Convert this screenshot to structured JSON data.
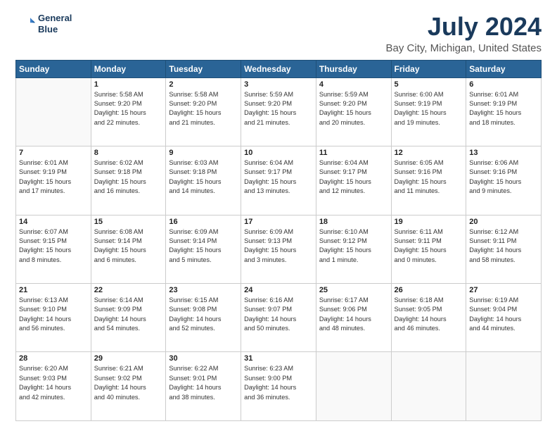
{
  "logo": {
    "line1": "General",
    "line2": "Blue"
  },
  "title": "July 2024",
  "subtitle": "Bay City, Michigan, United States",
  "headers": [
    "Sunday",
    "Monday",
    "Tuesday",
    "Wednesday",
    "Thursday",
    "Friday",
    "Saturday"
  ],
  "weeks": [
    [
      {
        "day": "",
        "info": ""
      },
      {
        "day": "1",
        "info": "Sunrise: 5:58 AM\nSunset: 9:20 PM\nDaylight: 15 hours\nand 22 minutes."
      },
      {
        "day": "2",
        "info": "Sunrise: 5:58 AM\nSunset: 9:20 PM\nDaylight: 15 hours\nand 21 minutes."
      },
      {
        "day": "3",
        "info": "Sunrise: 5:59 AM\nSunset: 9:20 PM\nDaylight: 15 hours\nand 21 minutes."
      },
      {
        "day": "4",
        "info": "Sunrise: 5:59 AM\nSunset: 9:20 PM\nDaylight: 15 hours\nand 20 minutes."
      },
      {
        "day": "5",
        "info": "Sunrise: 6:00 AM\nSunset: 9:19 PM\nDaylight: 15 hours\nand 19 minutes."
      },
      {
        "day": "6",
        "info": "Sunrise: 6:01 AM\nSunset: 9:19 PM\nDaylight: 15 hours\nand 18 minutes."
      }
    ],
    [
      {
        "day": "7",
        "info": "Sunrise: 6:01 AM\nSunset: 9:19 PM\nDaylight: 15 hours\nand 17 minutes."
      },
      {
        "day": "8",
        "info": "Sunrise: 6:02 AM\nSunset: 9:18 PM\nDaylight: 15 hours\nand 16 minutes."
      },
      {
        "day": "9",
        "info": "Sunrise: 6:03 AM\nSunset: 9:18 PM\nDaylight: 15 hours\nand 14 minutes."
      },
      {
        "day": "10",
        "info": "Sunrise: 6:04 AM\nSunset: 9:17 PM\nDaylight: 15 hours\nand 13 minutes."
      },
      {
        "day": "11",
        "info": "Sunrise: 6:04 AM\nSunset: 9:17 PM\nDaylight: 15 hours\nand 12 minutes."
      },
      {
        "day": "12",
        "info": "Sunrise: 6:05 AM\nSunset: 9:16 PM\nDaylight: 15 hours\nand 11 minutes."
      },
      {
        "day": "13",
        "info": "Sunrise: 6:06 AM\nSunset: 9:16 PM\nDaylight: 15 hours\nand 9 minutes."
      }
    ],
    [
      {
        "day": "14",
        "info": "Sunrise: 6:07 AM\nSunset: 9:15 PM\nDaylight: 15 hours\nand 8 minutes."
      },
      {
        "day": "15",
        "info": "Sunrise: 6:08 AM\nSunset: 9:14 PM\nDaylight: 15 hours\nand 6 minutes."
      },
      {
        "day": "16",
        "info": "Sunrise: 6:09 AM\nSunset: 9:14 PM\nDaylight: 15 hours\nand 5 minutes."
      },
      {
        "day": "17",
        "info": "Sunrise: 6:09 AM\nSunset: 9:13 PM\nDaylight: 15 hours\nand 3 minutes."
      },
      {
        "day": "18",
        "info": "Sunrise: 6:10 AM\nSunset: 9:12 PM\nDaylight: 15 hours\nand 1 minute."
      },
      {
        "day": "19",
        "info": "Sunrise: 6:11 AM\nSunset: 9:11 PM\nDaylight: 15 hours\nand 0 minutes."
      },
      {
        "day": "20",
        "info": "Sunrise: 6:12 AM\nSunset: 9:11 PM\nDaylight: 14 hours\nand 58 minutes."
      }
    ],
    [
      {
        "day": "21",
        "info": "Sunrise: 6:13 AM\nSunset: 9:10 PM\nDaylight: 14 hours\nand 56 minutes."
      },
      {
        "day": "22",
        "info": "Sunrise: 6:14 AM\nSunset: 9:09 PM\nDaylight: 14 hours\nand 54 minutes."
      },
      {
        "day": "23",
        "info": "Sunrise: 6:15 AM\nSunset: 9:08 PM\nDaylight: 14 hours\nand 52 minutes."
      },
      {
        "day": "24",
        "info": "Sunrise: 6:16 AM\nSunset: 9:07 PM\nDaylight: 14 hours\nand 50 minutes."
      },
      {
        "day": "25",
        "info": "Sunrise: 6:17 AM\nSunset: 9:06 PM\nDaylight: 14 hours\nand 48 minutes."
      },
      {
        "day": "26",
        "info": "Sunrise: 6:18 AM\nSunset: 9:05 PM\nDaylight: 14 hours\nand 46 minutes."
      },
      {
        "day": "27",
        "info": "Sunrise: 6:19 AM\nSunset: 9:04 PM\nDaylight: 14 hours\nand 44 minutes."
      }
    ],
    [
      {
        "day": "28",
        "info": "Sunrise: 6:20 AM\nSunset: 9:03 PM\nDaylight: 14 hours\nand 42 minutes."
      },
      {
        "day": "29",
        "info": "Sunrise: 6:21 AM\nSunset: 9:02 PM\nDaylight: 14 hours\nand 40 minutes."
      },
      {
        "day": "30",
        "info": "Sunrise: 6:22 AM\nSunset: 9:01 PM\nDaylight: 14 hours\nand 38 minutes."
      },
      {
        "day": "31",
        "info": "Sunrise: 6:23 AM\nSunset: 9:00 PM\nDaylight: 14 hours\nand 36 minutes."
      },
      {
        "day": "",
        "info": ""
      },
      {
        "day": "",
        "info": ""
      },
      {
        "day": "",
        "info": ""
      }
    ]
  ]
}
